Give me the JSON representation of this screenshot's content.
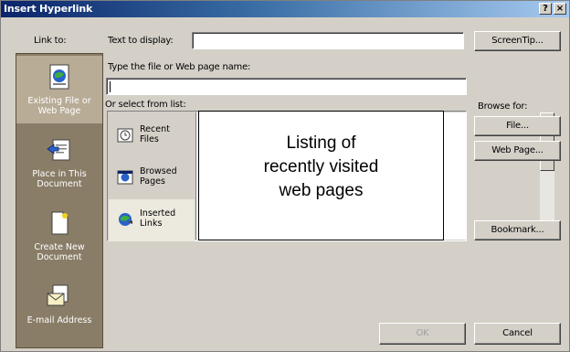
{
  "dialog": {
    "title": "Insert Hyperlink",
    "help_button": "?",
    "close_button": "×"
  },
  "link_to": {
    "label": "Link to:",
    "items": [
      {
        "label_line1": "Existing File or",
        "label_line2": "Web Page",
        "icon": "web-page-icon",
        "selected": true
      },
      {
        "label_line1": "Place in This",
        "label_line2": "Document",
        "icon": "place-in-document-icon",
        "selected": false
      },
      {
        "label_line1": "Create New",
        "label_line2": "Document",
        "icon": "new-document-icon",
        "selected": false
      },
      {
        "label_line1": "E-mail Address",
        "label_line2": "",
        "icon": "email-icon",
        "selected": false
      }
    ]
  },
  "text_to_display": {
    "label": "Text to display:",
    "value": ""
  },
  "screen_tip_button": "ScreenTip...",
  "file_name": {
    "label": "Type the file or Web page name:",
    "value": ""
  },
  "select_from_list": {
    "label": "Or select from list:",
    "categories": [
      {
        "line1": "Recent",
        "line2": "Files",
        "icon": "recent-files-icon",
        "selected": false
      },
      {
        "line1": "Browsed",
        "line2": "Pages",
        "icon": "browsed-pages-icon",
        "selected": false
      },
      {
        "line1": "Inserted",
        "line2": "Links",
        "icon": "inserted-links-icon",
        "selected": true
      }
    ],
    "callout": [
      "Listing of",
      "recently visited",
      "web pages"
    ]
  },
  "browse_for": {
    "label": "Browse for:",
    "file_button": "File...",
    "web_page_button": "Web Page..."
  },
  "bookmark_button": "Bookmark...",
  "ok_button": "OK",
  "cancel_button": "Cancel"
}
